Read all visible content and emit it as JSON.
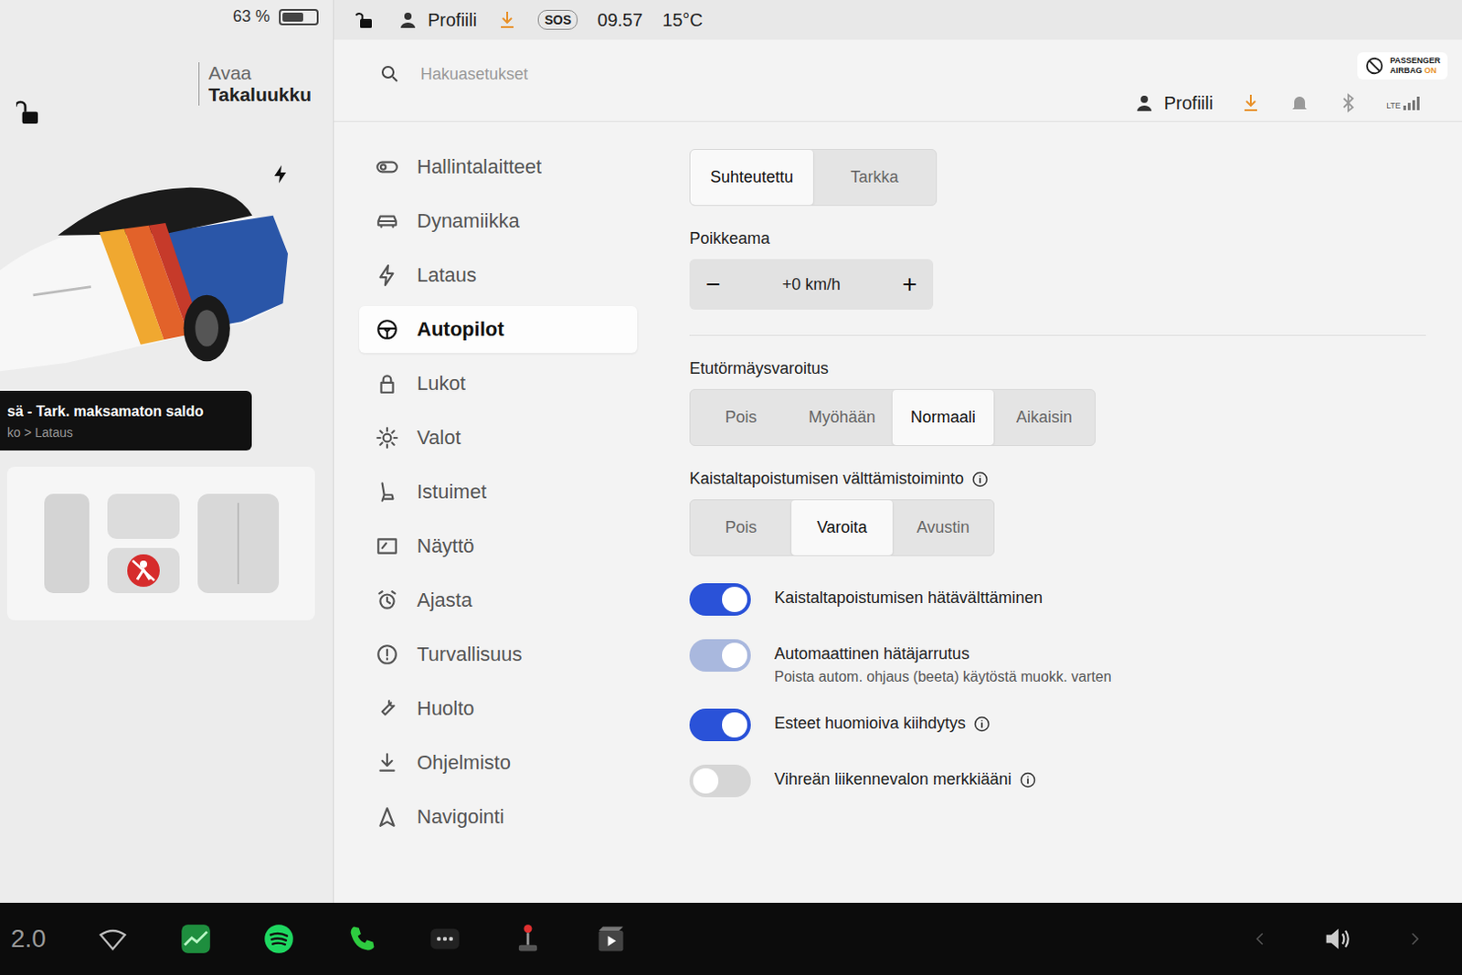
{
  "status_bar": {
    "battery": "63 %",
    "battery_level": 0.63,
    "locked": false,
    "profile": "Profiili",
    "sos": "SOS",
    "time": "09.57",
    "temperature": "15°C"
  },
  "car_panel": {
    "locked": false,
    "trunk_action": "Avaa",
    "trunk_label": "Takaluukku",
    "charging": true,
    "notification": {
      "title": "sä - Tark. maksamaton saldo",
      "subtitle": "ko > Lataus"
    },
    "airbag_warning": true
  },
  "search": {
    "placeholder": "Hakuasetukset"
  },
  "header": {
    "profile": "Profiili",
    "airbag_line1": "PASSENGER",
    "airbag_line2": "AIRBAG",
    "airbag_state": "ON",
    "network": "LTE"
  },
  "sidebar": {
    "items": [
      {
        "label": "Hallintalaitteet",
        "selected": false
      },
      {
        "label": "Dynamiikka",
        "selected": false
      },
      {
        "label": "Lataus",
        "selected": false
      },
      {
        "label": "Autopilot",
        "selected": true
      },
      {
        "label": "Lukot",
        "selected": false
      },
      {
        "label": "Valot",
        "selected": false
      },
      {
        "label": "Istuimet",
        "selected": false
      },
      {
        "label": "Näyttö",
        "selected": false
      },
      {
        "label": "Ajasta",
        "selected": false
      },
      {
        "label": "Turvallisuus",
        "selected": false
      },
      {
        "label": "Huolto",
        "selected": false
      },
      {
        "label": "Ohjelmisto",
        "selected": false
      },
      {
        "label": "Navigointi",
        "selected": false
      }
    ]
  },
  "settings": {
    "speed_mode": {
      "options": [
        {
          "label": "Suhteutettu",
          "selected": true
        },
        {
          "label": "Tarkka",
          "selected": false
        }
      ]
    },
    "offset": {
      "label": "Poikkeama",
      "minus": "−",
      "value": "+0 km/h",
      "plus": "+"
    },
    "forward_collision": {
      "label": "Etutörmäysvaroitus",
      "info": false,
      "options": [
        {
          "label": "Pois",
          "selected": false
        },
        {
          "label": "Myöhään",
          "selected": false
        },
        {
          "label": "Normaali",
          "selected": true
        },
        {
          "label": "Aikaisin",
          "selected": false
        }
      ]
    },
    "lane_departure": {
      "label": "Kaistaltapoistumisen välttämistoiminto",
      "info": true,
      "options": [
        {
          "label": "Pois",
          "selected": false
        },
        {
          "label": "Varoita",
          "selected": true
        },
        {
          "label": "Avustin",
          "selected": false
        }
      ]
    },
    "toggles": [
      {
        "label": "Kaistaltapoistumisen hätävälttäminen",
        "subtitle": "",
        "on": true,
        "disabled": false,
        "info": false
      },
      {
        "label": "Automaattinen hätäjarrutus",
        "subtitle": "Poista autom. ohjaus (beeta) käytöstä muokk. varten",
        "on": true,
        "disabled": true,
        "info": false
      },
      {
        "label": "Esteet huomioiva kiihdytys",
        "subtitle": "",
        "on": true,
        "disabled": false,
        "info": true
      },
      {
        "label": "Vihreän liikennevalon merkkiääni",
        "subtitle": "",
        "on": false,
        "disabled": false,
        "info": true
      }
    ]
  },
  "dock": {
    "speed": "2.0"
  }
}
